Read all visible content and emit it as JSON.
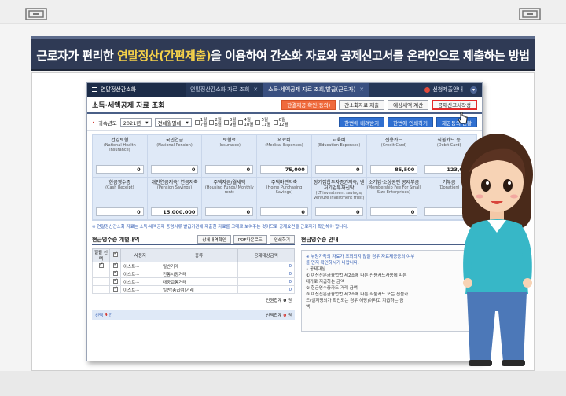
{
  "colors": {
    "banner_bg": "#2f3a55",
    "banner_highlight": "#f3d04a",
    "app_tab_bar": "#253757",
    "accent_orange": "#f06a3c",
    "accent_blue": "#2f6fd0",
    "highlight_red": "#e32a2a"
  },
  "banner": {
    "part1": "근로자가 편리한 ",
    "part_highlight": "연말정산(간편제출)",
    "part2": "을 이용하여 간소화 자료와 공제신고서를 온라인으로 제출하는 방법"
  },
  "app": {
    "tab_main": "연말정산간소화",
    "tabs": [
      {
        "label": "연말정산간소화 자료 조회",
        "active": false
      },
      {
        "label": "소득·세액공제 자료 조회/발급(근로자)",
        "active": true
      }
    ],
    "user_label": "신청제출안내",
    "page_title": "소득·세액공제 자료 조회",
    "top_buttons": {
      "consent": "한결제공 확인(동의)",
      "simple_submit": "간소화자료 제출",
      "tax_calc": "예상세액 계산",
      "deduction_form": "공제신고서작성"
    },
    "filter": {
      "year_label": "귀속년도",
      "year_value": "2021년",
      "period_value": "전체월별체",
      "months": [
        {
          "top": "1월",
          "bottom": "7월"
        },
        {
          "top": "2월",
          "bottom": "8월"
        },
        {
          "top": "3월",
          "bottom": "9월"
        },
        {
          "top": "4월",
          "bottom": "10월"
        },
        {
          "top": "5월",
          "bottom": "11월"
        },
        {
          "top": "6월",
          "bottom": "12월"
        }
      ],
      "download_all": "한번에 내려받기",
      "print_all": "한번에 인쇄하기",
      "view_status": "제공동의 현황"
    },
    "deductions": [
      {
        "label": "건강보험",
        "sub": "(National Health Insurance)",
        "value": "0"
      },
      {
        "label": "국민연금",
        "sub": "(National Pension)",
        "value": "0"
      },
      {
        "label": "보험료",
        "sub": "(Insurance)",
        "value": "0"
      },
      {
        "label": "의료비",
        "sub": "(Medical Expenses)",
        "value": "75,000"
      },
      {
        "label": "교육비",
        "sub": "(Education Expenses)",
        "value": "0"
      },
      {
        "label": "신용카드",
        "sub": "(Credit Card)",
        "value": "85,500"
      },
      {
        "label": "직불카드 등",
        "sub": "(Debit Card)",
        "value": "123,050"
      },
      {
        "label": "현금영수증",
        "sub": "(Cash Receipt)",
        "value": "0"
      },
      {
        "label": "개인연금저축/ 연금저축",
        "sub": "(Pension Savings)",
        "value": "15,000,000"
      },
      {
        "label": "주택자금/월세액",
        "sub": "(Housing Funds/ Monthly rent)",
        "value": "0"
      },
      {
        "label": "주택마련저축",
        "sub": "(Home Purchasing Savings)",
        "value": "0"
      },
      {
        "label": "장기집합투자증권저축/ 벤처기업투자신탁",
        "sub": "(LT investment savings/ Venture investment trust)",
        "value": "0"
      },
      {
        "label": "소기업·소상공인 공제부금",
        "sub": "(Membership Fee For Small Size Enterprises)",
        "value": "0"
      },
      {
        "label": "기부금",
        "sub": "(Donation)",
        "value": "0"
      }
    ],
    "notice": "※ 연말정산간소화 자료는 소득·세액공제 증명서류 발급기관에 제출한 자료를 그대로 보여주는 것이므로 공제요건을 근로자가 확인해야 합니다.",
    "cash_section": {
      "title": "현금영수증 개별내역",
      "buttons": {
        "detail": "상세내역확인",
        "pdf": "PDF다운로드",
        "print": "인쇄하기"
      },
      "headers": {
        "select": "일괄 선택",
        "user": "사용자",
        "type": "종류",
        "amount": "공제대상금액"
      },
      "rows": [
        {
          "user": "이스트···",
          "type": "일반거래",
          "amount": "0"
        },
        {
          "user": "이스트···",
          "type": "전통시장거래",
          "amount": "0"
        },
        {
          "user": "이스트···",
          "type": "대중교통거래",
          "amount": "0"
        },
        {
          "user": "이스트···",
          "type": "일반(총급여)거래",
          "amount": "0"
        }
      ],
      "total_label": "인원합계",
      "total_value": "0",
      "total_unit": "원",
      "select_label": "선택",
      "select_count": "4",
      "select_unit": "건",
      "select_sum_label": "선택합계",
      "select_sum_value": "0",
      "select_sum_unit": "원"
    },
    "guide_section": {
      "title": "현금영수증 안내",
      "lines": [
        "※ 부양가족의 자료가 조회되지 않을 경우 자료제공동의 여부",
        "   를 먼저 확인하시기 바랍니다.",
        "",
        "• 공제대상",
        "① 여신전문금융업법 제2조에 따른 신용카드사용에 따른",
        "   대가로 지급하는 금액",
        "② 현금영수증카드 거래 금액",
        "③ 여신전문금융업법 제2조에 따른 직불카드 또는 선불카",
        "   드(실지명의가 확인되는 경우 해당)이라고 지급하는 금",
        "   액"
      ]
    }
  }
}
